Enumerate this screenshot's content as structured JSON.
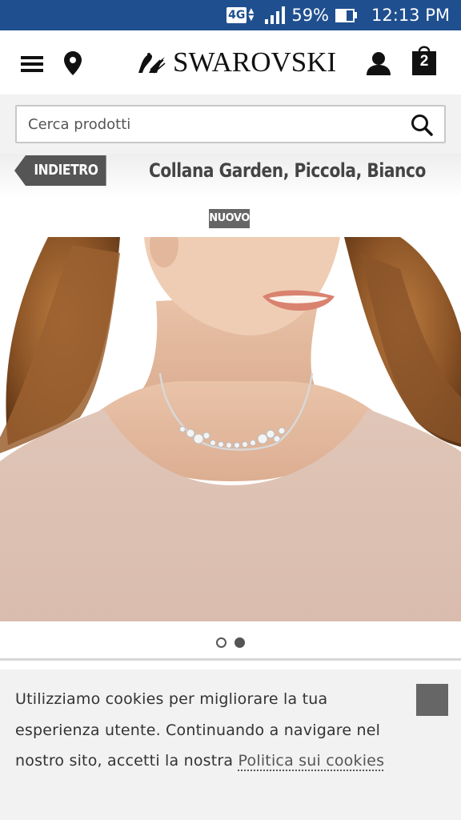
{
  "status_bar": {
    "network": "4G",
    "battery": "59%",
    "battery_level": 0.59,
    "time": "12:13 PM"
  },
  "header": {
    "brand": "SWAROVSKI",
    "cart_count": "2",
    "icons": [
      "menu-icon",
      "location-pin-icon",
      "swan-logo-icon",
      "user-icon",
      "shopping-bag-icon"
    ]
  },
  "search": {
    "placeholder": "Cerca prodotti",
    "value": ""
  },
  "breadcrumb": {
    "back_label": "INDIETRO",
    "product_title": "Collana Garden, Piccola, Bianco"
  },
  "product": {
    "badge": "NUOVO",
    "carousel_total": 2,
    "carousel_active": 2
  },
  "cookie_banner": {
    "text": "Utilizziamo cookies per migliorare la tua esperienza utente. Continuando a navigare nel nostro sito, accetti la nostra ",
    "link_text": "Politica sui cookies"
  },
  "colors": {
    "status_bar": "#1f4f8f",
    "back_button": "#555555",
    "badge": "#666666",
    "close_button": "#666666"
  }
}
